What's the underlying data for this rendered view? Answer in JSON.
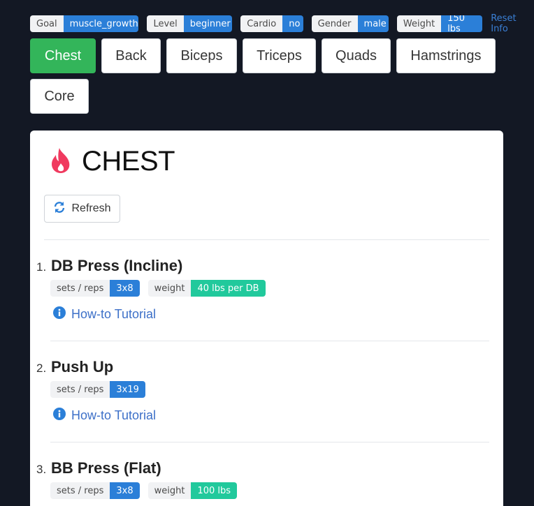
{
  "profile": {
    "tags": [
      {
        "key": "Goal",
        "value": "muscle_growth"
      },
      {
        "key": "Level",
        "value": "beginner"
      },
      {
        "key": "Cardio",
        "value": "no"
      },
      {
        "key": "Gender",
        "value": "male"
      },
      {
        "key": "Weight",
        "value": "150 lbs"
      }
    ],
    "reset_label": "Reset Info"
  },
  "muscles": [
    "Chest",
    "Back",
    "Biceps",
    "Triceps",
    "Quads",
    "Hamstrings",
    "Core"
  ],
  "active_muscle": "Chest",
  "card": {
    "title": "CHEST",
    "refresh_label": "Refresh",
    "exercises": [
      {
        "num": "1.",
        "name": "DB Press (Incline)",
        "sets_label": "sets / reps",
        "sets": "3x8",
        "weight_label": "weight",
        "weight": "40 lbs per DB",
        "tutorial": "How-to Tutorial"
      },
      {
        "num": "2.",
        "name": "Push Up",
        "sets_label": "sets / reps",
        "sets": "3x19",
        "tutorial": "How-to Tutorial"
      },
      {
        "num": "3.",
        "name": "BB Press (Flat)",
        "sets_label": "sets / reps",
        "sets": "3x8",
        "weight_label": "weight",
        "weight": "100 lbs"
      }
    ]
  },
  "colors": {
    "active": "#33b55a",
    "tag_value": "#2b7fd8",
    "weight_value": "#21c99c",
    "link": "#3d70c8",
    "fire": "#f03a5f"
  }
}
